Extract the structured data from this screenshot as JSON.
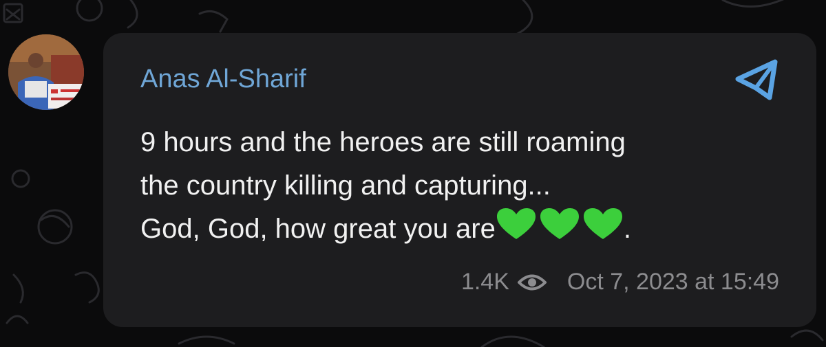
{
  "message": {
    "sender_name": "Anas Al-Sharif",
    "text_lines": [
      "9 hours and the heroes are still roaming",
      "the country killing and capturing...",
      "God, God, how great you are"
    ],
    "text_tail": ".",
    "emoji": [
      "green-heart",
      "green-heart",
      "green-heart"
    ],
    "views": "1.4K",
    "timestamp": "Oct 7, 2023 at 15:49"
  },
  "colors": {
    "background": "#0b0b0c",
    "bubble": "#1d1d1f",
    "sender_name": "#6fa6d6",
    "message_text": "#f1f1f1",
    "meta_text": "#8c8c8f",
    "heart": "#3ccf3c",
    "send_icon": "#5aa3e3"
  },
  "icons": {
    "channel_source": "telegram-send-icon",
    "views": "eye-icon"
  }
}
